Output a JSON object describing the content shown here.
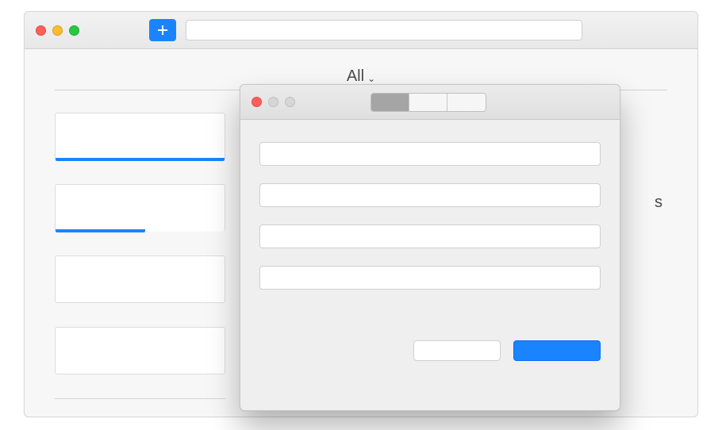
{
  "main": {
    "tabs": {
      "selected_label": "All"
    },
    "right_hint_char": "s"
  },
  "dialog": {
    "segments": [
      "",
      "",
      ""
    ],
    "fields": [
      {
        "placeholder": ""
      },
      {
        "placeholder": ""
      },
      {
        "placeholder": ""
      },
      {
        "placeholder": ""
      }
    ],
    "buttons": {
      "cancel": "",
      "confirm": ""
    }
  }
}
